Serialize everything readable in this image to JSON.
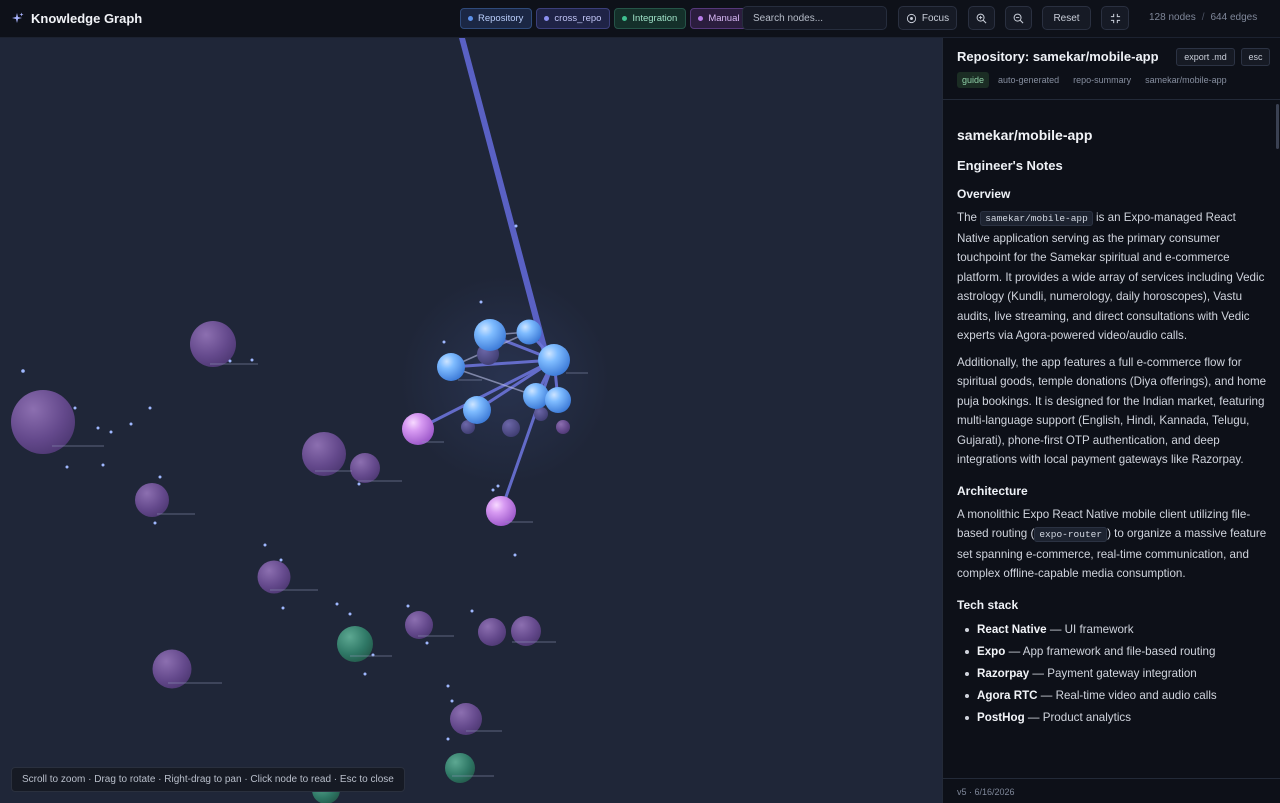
{
  "app": {
    "title": "Knowledge Graph"
  },
  "filters": [
    {
      "label": "Repository"
    },
    {
      "label": "cross_repo"
    },
    {
      "label": "Integration"
    },
    {
      "label": "Manual"
    }
  ],
  "search": {
    "placeholder": "Search nodes..."
  },
  "toolbar": {
    "focus_label": "Focus",
    "reset_label": "Reset"
  },
  "stats": {
    "nodes": "128 nodes",
    "separator": "/",
    "edges": "644 edges"
  },
  "canvas": {
    "hint": "Scroll to zoom · Drag to rotate · Right-drag to pan · Click node to read · Esc to close"
  },
  "panel": {
    "title": "Repository: samekar/mobile-app",
    "export_label": "export .md",
    "esc_label": "esc",
    "tags": [
      "guide",
      "auto-generated",
      "repo-summary",
      "samekar/mobile-app"
    ],
    "doc": {
      "h1": "samekar/mobile-app",
      "h2": "Engineer's Notes",
      "overview_heading": "Overview",
      "p1_pre": "The ",
      "p1_code": "samekar/mobile-app",
      "p1_post": " is an Expo-managed React Native application serving as the primary consumer touchpoint for the Samekar spiritual and e-commerce platform. It provides a wide array of services including Vedic astrology (Kundli, numerology, daily horoscopes), Vastu audits, live streaming, and direct consultations with Vedic experts via Agora-powered video/audio calls.",
      "p2": "Additionally, the app features a full e-commerce flow for spiritual goods, temple donations (Diya offerings), and home puja bookings. It is designed for the Indian market, featuring multi-language support (English, Hindi, Kannada, Telugu, Gujarati), phone-first OTP authentication, and deep integrations with local payment gateways like Razorpay.",
      "arch_heading": "Architecture",
      "p3_pre": "A monolithic Expo React Native mobile client utilizing file-based routing (",
      "p3_code": "expo-router",
      "p3_post": ") to organize a massive feature set spanning e-commerce, real-time communication, and complex offline-capable media consumption.",
      "stack_heading": "Tech stack",
      "stack": [
        {
          "name": "React Native",
          "desc": " — UI framework"
        },
        {
          "name": "Expo",
          "desc": " — App framework and file-based routing"
        },
        {
          "name": "Razorpay",
          "desc": " — Payment gateway integration"
        },
        {
          "name": "Agora RTC",
          "desc": " — Real-time video and audio calls"
        },
        {
          "name": "PostHog",
          "desc": " — Product analytics"
        }
      ]
    },
    "footer": "v5 · 6/16/2026"
  },
  "colors": {
    "background": "#1f2638",
    "repository": "#5b8fe8",
    "cross_repo": "#8b8ff0",
    "integration": "#3fbf8f",
    "manual": "#b67ae8",
    "edge": "#6b73d8"
  }
}
